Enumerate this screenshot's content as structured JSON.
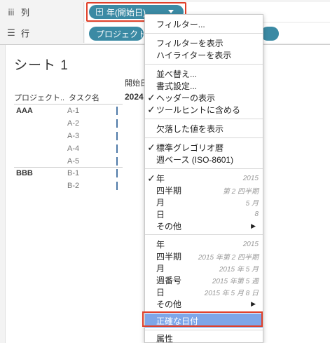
{
  "shelves": {
    "columns": {
      "icon": "columns-icon",
      "icon_glyph": "iii",
      "label": "列",
      "pill": {
        "text": "年(開始日)",
        "color": "#3b8aa4"
      }
    },
    "rows": {
      "icon": "rows-icon",
      "icon_glyph": "☰",
      "label": "行",
      "pill": {
        "text": "プロジェクト名",
        "color": "#3b8aa4"
      }
    }
  },
  "sheet": {
    "title": "シート 1",
    "header_top": "開始日",
    "header_year": "2024",
    "col_project": "プロジェクト..",
    "col_task": "タスク名",
    "groups": [
      {
        "name": "AAA",
        "tasks": [
          "A-1",
          "A-2",
          "A-3",
          "A-4",
          "A-5"
        ]
      },
      {
        "name": "BBB",
        "tasks": [
          "B-1",
          "B-2"
        ]
      }
    ]
  },
  "menu": {
    "filter": "フィルター...",
    "show_filter": "フィルターを表示",
    "show_highlighter": "ハイライターを表示",
    "sort": "並べ替え...",
    "format": "書式設定...",
    "show_header": "ヘッダーの表示",
    "include_tooltip": "ツールヒントに含める",
    "show_missing": "欠落した値を表示",
    "gregorian": "標準グレゴリオ暦",
    "iso_week": "週ベース (ISO-8601)",
    "discrete": [
      {
        "label": "年",
        "value": "2015"
      },
      {
        "label": "四半期",
        "value": "第 2 四半期"
      },
      {
        "label": "月",
        "value": "5 月"
      },
      {
        "label": "日",
        "value": "8"
      },
      {
        "label": "その他",
        "value": ""
      }
    ],
    "continuous": [
      {
        "label": "年",
        "value": "2015"
      },
      {
        "label": "四半期",
        "value": "2015 年第 2 四半期"
      },
      {
        "label": "月",
        "value": "2015 年 5 月"
      },
      {
        "label": "週番号",
        "value": "2015 年第 5 週"
      },
      {
        "label": "日",
        "value": "2015 年 5 月 8 日"
      },
      {
        "label": "その他",
        "value": ""
      }
    ],
    "exact_date": "正確な日付",
    "attribute": "属性",
    "highlight_color": "#7ea6e8",
    "check_glyph": "✓",
    "submenu_glyph": "▶"
  },
  "colors": {
    "accent": "#3b8aa4",
    "annotation": "#e0402a",
    "tick": "#4e79a7"
  }
}
